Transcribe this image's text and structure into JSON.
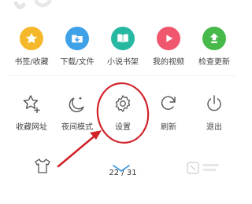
{
  "menu": {
    "row1": [
      {
        "label": "书签/收藏",
        "icon": "star-icon",
        "color": "#f5b82a"
      },
      {
        "label": "下载/文件",
        "icon": "download-folder-icon",
        "color": "#3fa1e8"
      },
      {
        "label": "小说书架",
        "icon": "book-icon",
        "color": "#27b8a1"
      },
      {
        "label": "我的视频",
        "icon": "play-icon",
        "color": "#f0566d"
      },
      {
        "label": "检查更新",
        "icon": "update-arrow-icon",
        "color": "#46b94a"
      }
    ],
    "row2": [
      {
        "label": "收藏网址",
        "icon": "star-plus-icon"
      },
      {
        "label": "夜间模式",
        "icon": "moon-icon"
      },
      {
        "label": "设置",
        "icon": "gear-icon"
      },
      {
        "label": "刷新",
        "icon": "refresh-icon"
      },
      {
        "label": "退出",
        "icon": "power-icon"
      }
    ]
  },
  "bottom": {
    "page_indicator": "22 / 31",
    "icons": [
      "shirt-icon",
      "chevron-down-icon"
    ]
  },
  "annotation": {
    "color": "#d0232a"
  }
}
